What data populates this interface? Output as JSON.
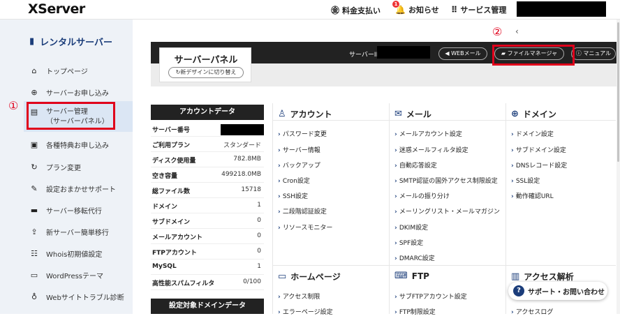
{
  "logo": "XServer",
  "topnav": {
    "billing": "料金支払い",
    "notices": "お知らせ",
    "notice_count": "1",
    "service": "サービス管理"
  },
  "sidebar": {
    "title": "レンタルサーバー",
    "items": [
      {
        "label": "トップページ",
        "icon": "home-icon"
      },
      {
        "label": "サーバーお申し込み",
        "icon": "plus-icon"
      },
      {
        "label": "サーバー管理",
        "label2": "（サーバーパネル）",
        "icon": "server-icon"
      },
      {
        "label": "各種特典お申し込み",
        "icon": "gift-icon"
      },
      {
        "label": "プラン変更",
        "icon": "refresh-icon"
      },
      {
        "label": "設定おまかせサポート",
        "icon": "wrench-icon"
      },
      {
        "label": "サーバー移転代行",
        "icon": "truck-icon"
      },
      {
        "label": "新サーバー簡単移行",
        "icon": "upload-icon"
      },
      {
        "label": "Whois初期値設定",
        "icon": "form-icon"
      },
      {
        "label": "WordPressテーマ",
        "icon": "window-icon"
      },
      {
        "label": "Webサイトトラブル診断",
        "icon": "stethoscope-icon"
      }
    ]
  },
  "annotations": {
    "one": "①",
    "two": "②"
  },
  "back": "‹",
  "panel": {
    "title": "サーバーパネル",
    "redesign": "新デザインに切り替え",
    "serverid_label": "サーバーID",
    "buttons": {
      "webmail": "WEBメール",
      "filemanager": "ファイルマネージャ",
      "manual": "マニュアル"
    }
  },
  "account": {
    "title": "アカウントデータ",
    "rows": [
      {
        "k": "サーバー番号",
        "v": ""
      },
      {
        "k": "ご利用プラン",
        "v": "スタンダード"
      },
      {
        "k": "ディスク使用量",
        "v": "782.8MB"
      },
      {
        "k": "空き容量",
        "v": "499218.0MB"
      },
      {
        "k": "総ファイル数",
        "v": "15718"
      },
      {
        "k": "ドメイン",
        "v": "1"
      },
      {
        "k": "サブドメイン",
        "v": "0"
      },
      {
        "k": "メールアカウント",
        "v": "0"
      },
      {
        "k": "FTPアカウント",
        "v": "0"
      },
      {
        "k": "MySQL",
        "v": "1"
      },
      {
        "k": "高性能スパムフィルタ",
        "v": "0/100"
      }
    ],
    "title2": "設定対象ドメインデータ"
  },
  "sections": {
    "account": {
      "title": "アカウント",
      "links": [
        "パスワード変更",
        "サーバー情報",
        "バックアップ",
        "Cron設定",
        "SSH設定",
        "二段階認証設定",
        "リソースモニター"
      ]
    },
    "mail": {
      "title": "メール",
      "links": [
        "メールアカウント設定",
        "迷惑メールフィルタ設定",
        "自動応答設定",
        "SMTP認証の国外アクセス制限設定",
        "メールの振り分け",
        "メーリングリスト・メールマガジン",
        "DKIM設定",
        "SPF設定",
        "DMARC設定"
      ]
    },
    "domain": {
      "title": "ドメイン",
      "links": [
        "ドメイン設定",
        "サブドメイン設定",
        "DNSレコード設定",
        "SSL設定",
        "動作確認URL"
      ]
    },
    "homepage": {
      "title": "ホームページ",
      "links": [
        "アクセス制限",
        "エラーページ設定"
      ]
    },
    "ftp": {
      "title": "FTP",
      "links": [
        "サブFTPアカウント設定",
        "FTP制限設定"
      ]
    },
    "analytics": {
      "title": "アクセス解析",
      "links": [
        "アクセスログ"
      ]
    }
  },
  "support": "サポート・お問い合わせ"
}
